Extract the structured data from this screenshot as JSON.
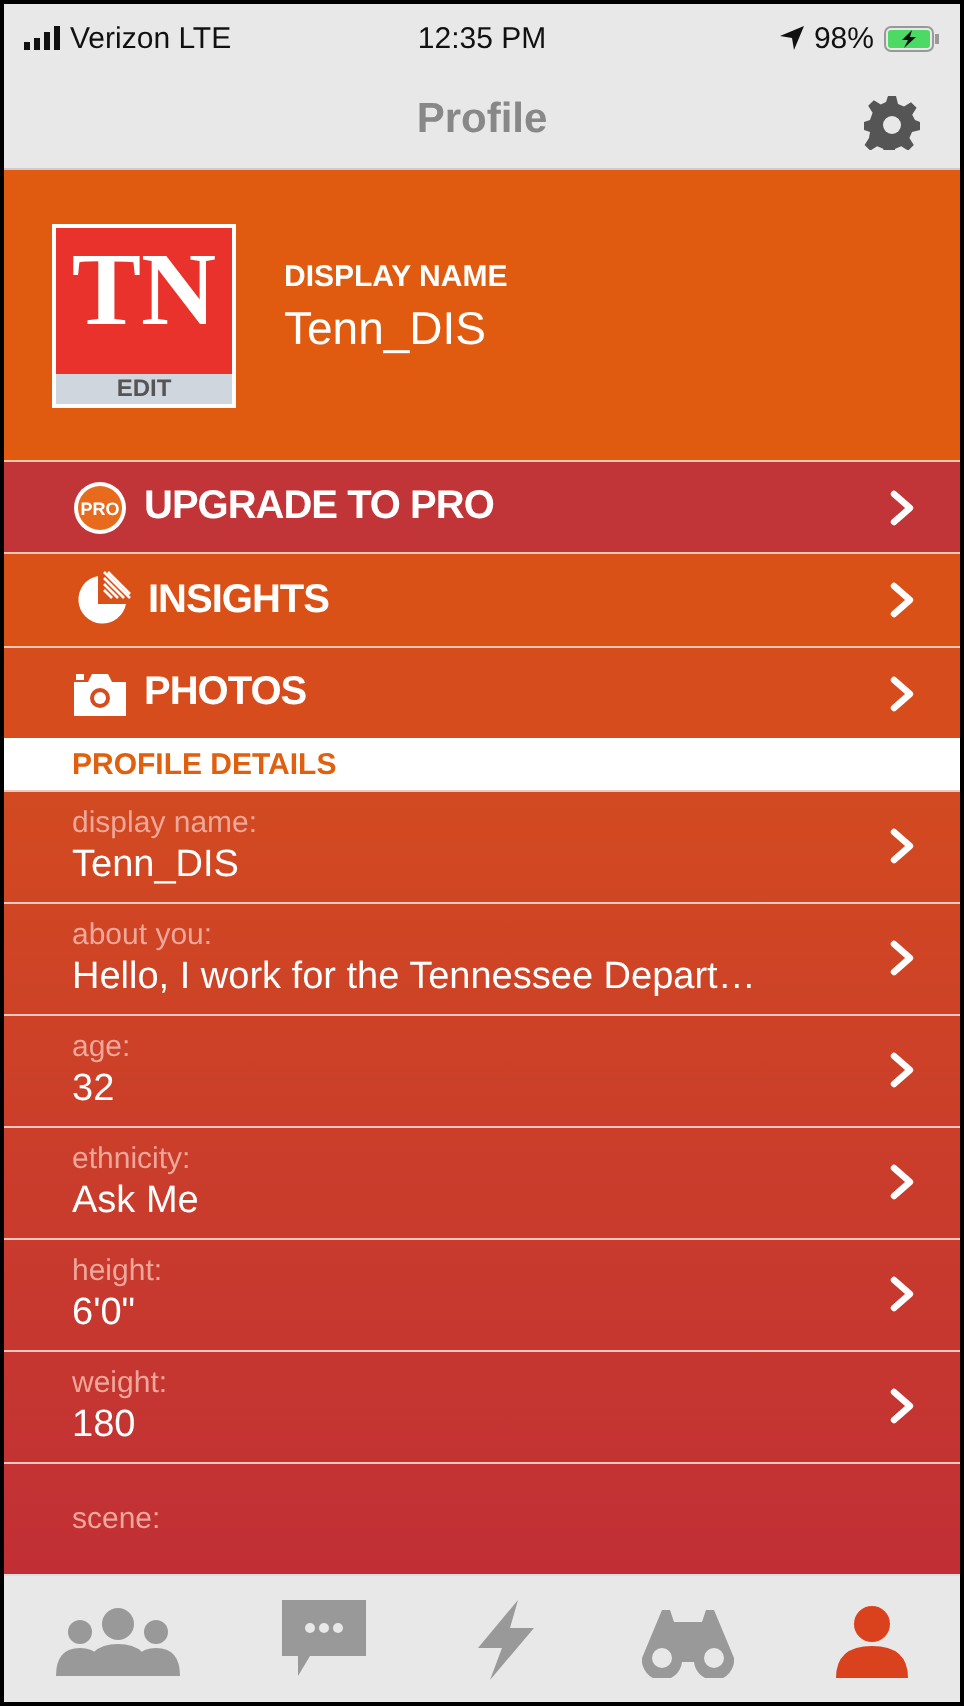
{
  "status_bar": {
    "carrier": "Verizon LTE",
    "time": "12:35 PM",
    "battery": "98%"
  },
  "nav": {
    "title": "Profile"
  },
  "profile": {
    "avatar_text": "TN",
    "avatar_action": "EDIT",
    "label": "DISPLAY NAME",
    "name": "Tenn_DIS"
  },
  "menu": [
    {
      "kind": "pro",
      "icon_text": "PRO",
      "label": "UPGRADE TO PRO",
      "color": "#c13437"
    },
    {
      "kind": "insights",
      "label": "INSIGHTS",
      "color": "#da5118"
    },
    {
      "kind": "photos",
      "label": "PHOTOS",
      "color": "#d64c1c"
    }
  ],
  "section": "PROFILE DETAILS",
  "details": [
    {
      "label": "display name:",
      "value": "Tenn_DIS"
    },
    {
      "label": "about you:",
      "value": "Hello, I work for the Tennessee Depart…"
    },
    {
      "label": "age:",
      "value": "32"
    },
    {
      "label": "ethnicity:",
      "value": "Ask Me"
    },
    {
      "label": "height:",
      "value": "6'0\""
    },
    {
      "label": "weight:",
      "value": "180"
    },
    {
      "label": "scene:"
    }
  ],
  "tabs": [
    {
      "kind": "people",
      "selected": false
    },
    {
      "kind": "chat",
      "selected": false
    },
    {
      "kind": "bolt",
      "selected": false
    },
    {
      "kind": "binoculars",
      "selected": false
    },
    {
      "kind": "profile",
      "selected": true
    }
  ]
}
